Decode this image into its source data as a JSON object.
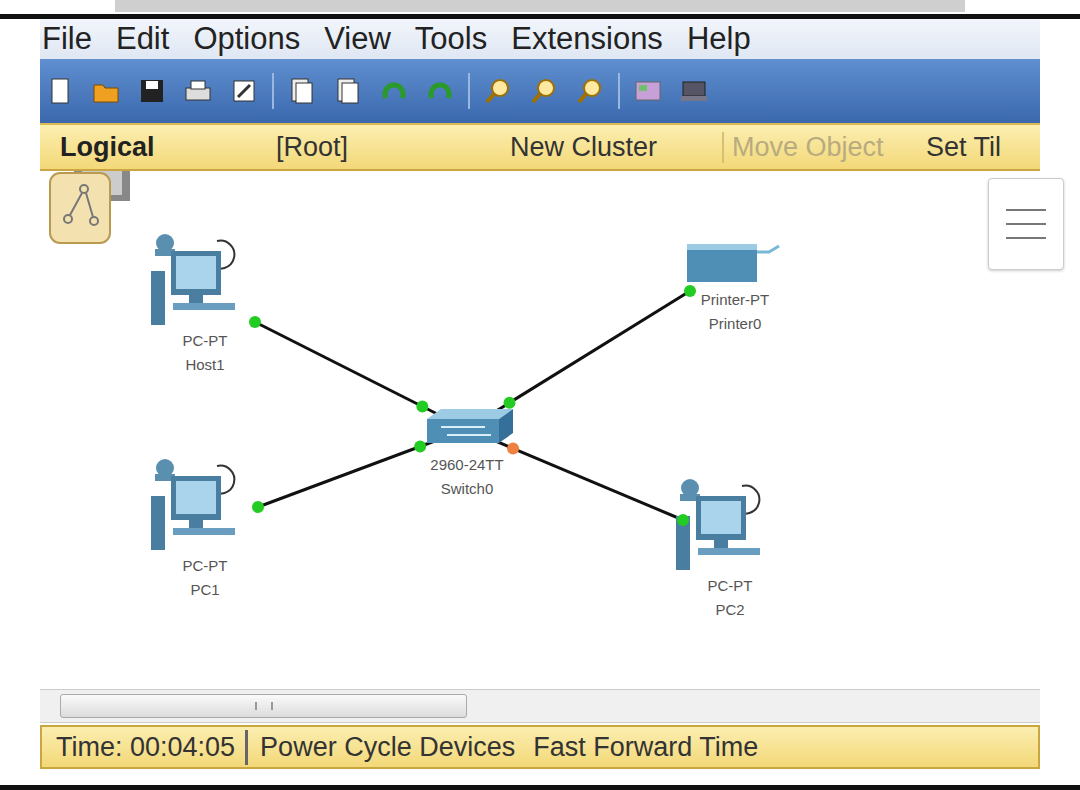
{
  "menu": [
    {
      "label": "File"
    },
    {
      "label": "Edit"
    },
    {
      "label": "Options"
    },
    {
      "label": "View"
    },
    {
      "label": "Tools"
    },
    {
      "label": "Extensions"
    },
    {
      "label": "Help"
    }
  ],
  "workspace_bar": {
    "items": [
      {
        "label": "Logical",
        "selected": true,
        "disabled": false
      },
      {
        "label": "[Root]",
        "selected": false,
        "disabled": false
      },
      {
        "label": "New Cluster",
        "selected": false,
        "disabled": false
      },
      {
        "label": "Move Object",
        "selected": false,
        "disabled": true
      },
      {
        "label": "Set Til",
        "selected": false,
        "disabled": false
      }
    ]
  },
  "devices": [
    {
      "name": "Host1",
      "model": "PC-PT",
      "kind": "pc"
    },
    {
      "name": "PC1",
      "model": "PC-PT",
      "kind": "pc"
    },
    {
      "name": "Switch0",
      "model": "2960-24TT",
      "kind": "switch"
    },
    {
      "name": "Printer0",
      "model": "Printer-PT",
      "kind": "printer"
    },
    {
      "name": "PC2",
      "model": "PC-PT",
      "kind": "pc"
    }
  ],
  "links": [
    {
      "from": "Host1",
      "to": "Switch0",
      "from_color": "#22cc22",
      "to_color": "#22cc22"
    },
    {
      "from": "PC1",
      "to": "Switch0",
      "from_color": "#22cc22",
      "to_color": "#22cc22"
    },
    {
      "from": "Printer0",
      "to": "Switch0",
      "from_color": "#22cc22",
      "to_color": "#22cc22"
    },
    {
      "from": "PC2",
      "to": "Switch0",
      "from_color": "#22cc22",
      "to_color": "#f08040"
    }
  ],
  "status_bar": {
    "time": "Time: 00:04:05",
    "buttons": [
      "Power Cycle Devices",
      "Fast Forward Time"
    ]
  }
}
